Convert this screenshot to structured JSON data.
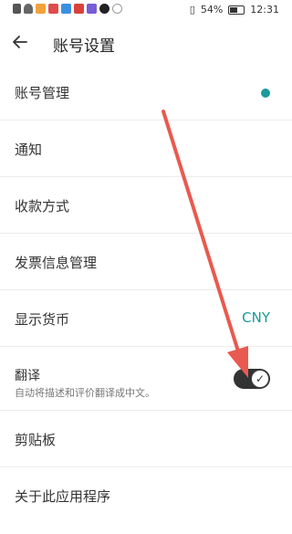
{
  "statusbar": {
    "battery": "54%",
    "time": "12:31"
  },
  "header": {
    "title": "账号设置"
  },
  "settings": {
    "account": "账号管理",
    "notify": "通知",
    "payment": "收款方式",
    "invoice": "发票信息管理",
    "currency_label": "显示货币",
    "currency_value": "CNY",
    "translate_label": "翻译",
    "translate_desc": "自动将描述和评价翻译成中文。",
    "translate_on": true,
    "clipboard": "剪贴板",
    "about": "关于此应用程序"
  },
  "colors": {
    "accent": "#1a9a9a",
    "arrow": "#e85a4f"
  }
}
